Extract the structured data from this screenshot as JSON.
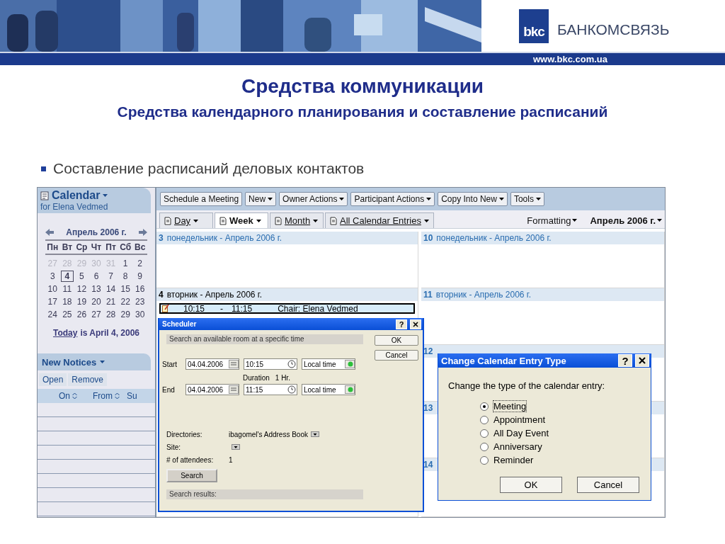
{
  "header": {
    "logo_mark": "bkc",
    "logo_name": "БАНКОМСВЯЗЬ",
    "url": "www.bkc.com.ua"
  },
  "title": "Средства коммуникации",
  "subtitle": "Средства календарного планирования и составление расписаний",
  "bullets": [
    "Составление расписаний деловых контактов"
  ],
  "app": {
    "sidebar": {
      "title": "Calendar",
      "owner": "for Elena Vedmed",
      "month": "Апрель 2006 г.",
      "weekdays": [
        "Пн",
        "Вт",
        "Ср",
        "Чт",
        "Пт",
        "Сб",
        "Вс"
      ],
      "weeks": [
        {
          "days": [
            {
              "d": "27",
              "muted": true,
              "selected": false
            },
            {
              "d": "28",
              "muted": true,
              "selected": false
            },
            {
              "d": "29",
              "muted": true,
              "selected": false
            },
            {
              "d": "30",
              "muted": true,
              "selected": false
            },
            {
              "d": "31",
              "muted": true,
              "selected": false
            },
            {
              "d": "1",
              "muted": false,
              "selected": false
            },
            {
              "d": "2",
              "muted": false,
              "selected": false
            }
          ]
        },
        {
          "days": [
            {
              "d": "3",
              "muted": false,
              "selected": false
            },
            {
              "d": "4",
              "muted": false,
              "selected": true
            },
            {
              "d": "5",
              "muted": false,
              "selected": false
            },
            {
              "d": "6",
              "muted": false,
              "selected": false
            },
            {
              "d": "7",
              "muted": false,
              "selected": false
            },
            {
              "d": "8",
              "muted": false,
              "selected": false
            },
            {
              "d": "9",
              "muted": false,
              "selected": false
            }
          ]
        },
        {
          "days": [
            {
              "d": "10",
              "muted": false,
              "selected": false
            },
            {
              "d": "11",
              "muted": false,
              "selected": false
            },
            {
              "d": "12",
              "muted": false,
              "selected": false
            },
            {
              "d": "13",
              "muted": false,
              "selected": false
            },
            {
              "d": "14",
              "muted": false,
              "selected": false
            },
            {
              "d": "15",
              "muted": false,
              "selected": false
            },
            {
              "d": "16",
              "muted": false,
              "selected": false
            }
          ]
        },
        {
          "days": [
            {
              "d": "17",
              "muted": false,
              "selected": false
            },
            {
              "d": "18",
              "muted": false,
              "selected": false
            },
            {
              "d": "19",
              "muted": false,
              "selected": false
            },
            {
              "d": "20",
              "muted": false,
              "selected": false
            },
            {
              "d": "21",
              "muted": false,
              "selected": false
            },
            {
              "d": "22",
              "muted": false,
              "selected": false
            },
            {
              "d": "23",
              "muted": false,
              "selected": false
            }
          ]
        },
        {
          "days": [
            {
              "d": "24",
              "muted": false,
              "selected": false
            },
            {
              "d": "25",
              "muted": false,
              "selected": false
            },
            {
              "d": "26",
              "muted": false,
              "selected": false
            },
            {
              "d": "27",
              "muted": false,
              "selected": false
            },
            {
              "d": "28",
              "muted": false,
              "selected": false
            },
            {
              "d": "29",
              "muted": false,
              "selected": false
            },
            {
              "d": "30",
              "muted": false,
              "selected": false
            }
          ]
        }
      ],
      "today_link": "Today",
      "today_text": "is April 4, 2006",
      "notices": {
        "title": "New Notices",
        "actions": [
          "Open",
          "Remove"
        ],
        "columns": [
          {
            "label": "On",
            "sortable": true
          },
          {
            "label": "From",
            "sortable": true
          },
          {
            "label": "Su",
            "sortable": false
          }
        ]
      }
    },
    "toolbar": [
      {
        "label": "Schedule a Meeting",
        "menu": false
      },
      {
        "label": "New",
        "menu": true
      },
      {
        "label": "Owner Actions",
        "menu": true
      },
      {
        "label": "Participant Actions",
        "menu": true
      },
      {
        "label": "Copy Into New",
        "menu": true
      },
      {
        "label": "Tools",
        "menu": true
      }
    ],
    "view_tabs": [
      {
        "label": "Day",
        "selected": false
      },
      {
        "label": "Week",
        "selected": true
      },
      {
        "label": "Month",
        "selected": false
      },
      {
        "label": "All Calendar Entries",
        "selected": false
      }
    ],
    "formatting": "Formatting",
    "period": "Апрель 2006 г.",
    "columns": [
      [
        {
          "day": "3",
          "label": "понедельник - Апрель 2006 г.",
          "current": false
        },
        {
          "day": "4",
          "label": "вторник - Апрель 2006 г.",
          "current": true,
          "events": [
            {
              "start": "10:15",
              "separator": "-",
              "end": "11:15",
              "chair": "Chair: Elena Vedmed"
            }
          ]
        }
      ],
      [
        {
          "day": "10",
          "label": "понедельник - Апрель 2006 г.",
          "current": false
        },
        {
          "day": "11",
          "label": "вторник - Апрель 2006 г.",
          "current": false
        },
        {
          "day": "12",
          "current": false
        },
        {
          "day": "13",
          "current": false
        },
        {
          "day": "14",
          "current": false
        }
      ]
    ],
    "scheduler": {
      "title": "Scheduler",
      "help": "?",
      "section": "Search an available room at a specific time",
      "buttons": [
        "OK",
        "Cancel"
      ],
      "times": [
        {
          "label": "Start",
          "date": "04.04.2006",
          "time": "10:15",
          "zone": "Local time"
        },
        {
          "label": "End",
          "date": "04.04.2006",
          "time": "11:15",
          "zone": "Local time"
        }
      ],
      "duration_label": "Duration",
      "duration": "1 Hr.",
      "fields": [
        {
          "label": "Directories:",
          "value": "ibagomel's Address Book",
          "menu": true
        },
        {
          "label": "Site:",
          "menu": true
        },
        {
          "label": "# of attendees:",
          "value": "1",
          "menu": false
        }
      ],
      "search_button": "Search",
      "results": "Search results:"
    },
    "entry_dialog": {
      "title": "Change Calendar Entry Type",
      "help": "?",
      "prompt": "Change the type of the calendar entry:",
      "options": [
        {
          "label": "Meeting",
          "selected": true
        },
        {
          "label": "Appointment",
          "selected": false
        },
        {
          "label": "All Day Event",
          "selected": false
        },
        {
          "label": "Anniversary",
          "selected": false
        },
        {
          "label": "Reminder",
          "selected": false
        }
      ],
      "buttons": [
        "OK",
        "Cancel"
      ]
    }
  }
}
